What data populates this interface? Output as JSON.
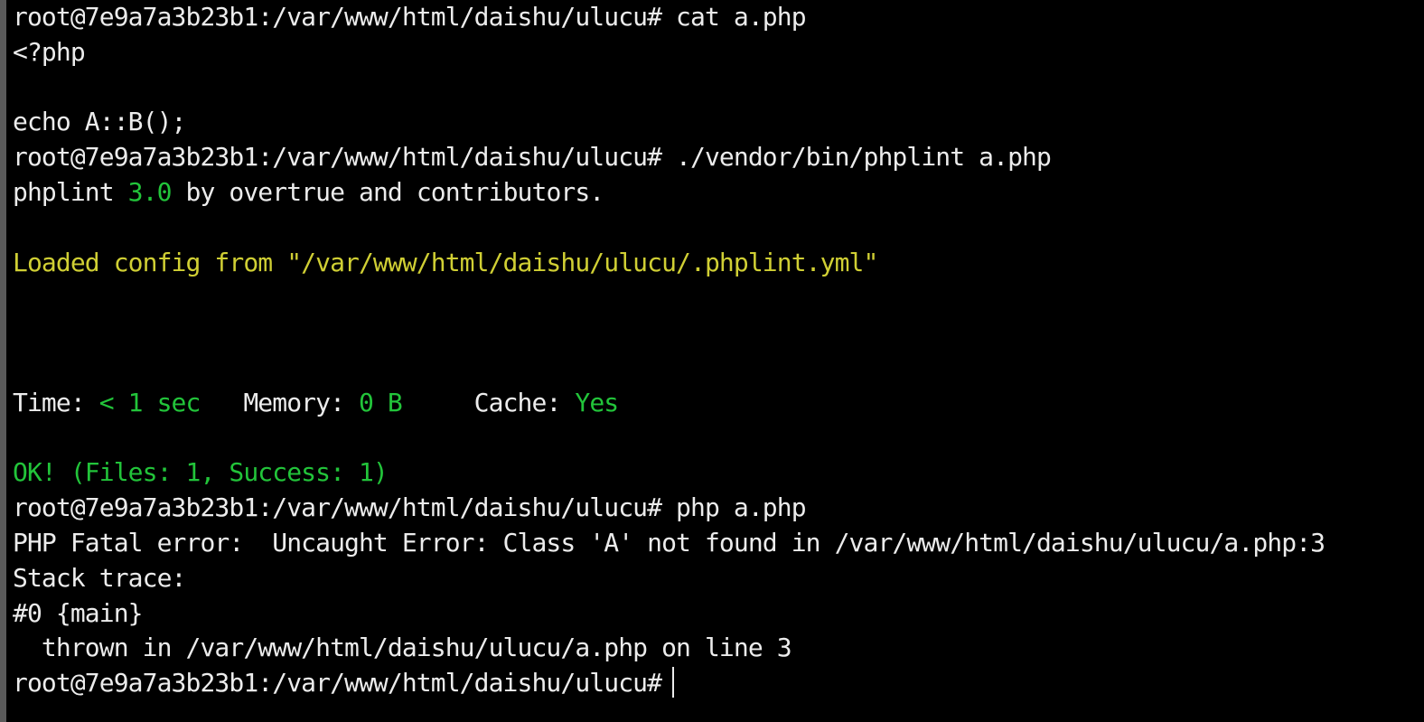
{
  "lines": {
    "l0": {
      "prompt": "root@7e9a7a3b23b1:/var/www/html/daishu/ulucu#",
      "command": " cat a.php"
    },
    "l1": {
      "text": "<?php"
    },
    "l2": {
      "text": ""
    },
    "l3": {
      "text": "echo A::B();"
    },
    "l4": {
      "prompt": "root@7e9a7a3b23b1:/var/www/html/daishu/ulucu#",
      "command": " ./vendor/bin/phplint a.php"
    },
    "l5": {
      "pre": "phplint ",
      "version": "3.0",
      "post": " by overtrue and contributors."
    },
    "l6": {
      "text": ""
    },
    "l7": {
      "text": "Loaded config from \"/var/www/html/daishu/ulucu/.phplint.yml\""
    },
    "l8": {
      "text": ""
    },
    "l9": {
      "text": ""
    },
    "l10": {
      "text": ""
    },
    "l11": {
      "time_label": "Time: ",
      "time_value": "< 1 sec",
      "gap1": "   ",
      "memory_label": "Memory: ",
      "memory_value": "0 B",
      "gap2": "     ",
      "cache_label": "Cache: ",
      "cache_value": "Yes"
    },
    "l12": {
      "text": ""
    },
    "l13": {
      "text": "OK! (Files: 1, Success: 1)"
    },
    "l14": {
      "prompt": "root@7e9a7a3b23b1:/var/www/html/daishu/ulucu#",
      "command": " php a.php"
    },
    "l15": {
      "text": "PHP Fatal error:  Uncaught Error: Class 'A' not found in /var/www/html/daishu/ulucu/a.php:3"
    },
    "l16": {
      "text": "Stack trace:"
    },
    "l17": {
      "text": "#0 {main}"
    },
    "l18": {
      "text": "  thrown in /var/www/html/daishu/ulucu/a.php on line 3"
    },
    "l19": {
      "prompt": "root@7e9a7a3b23b1:/var/www/html/daishu/ulucu#",
      "command": ""
    }
  },
  "colors": {
    "background": "#000000",
    "foreground": "#ececec",
    "green": "#22c43a",
    "yellow": "#d0cf34"
  }
}
